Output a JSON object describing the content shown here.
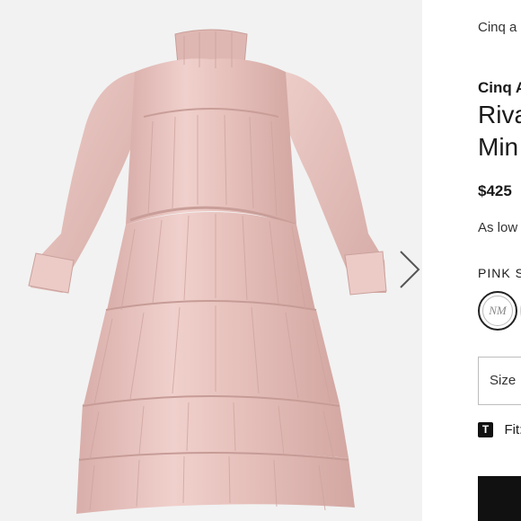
{
  "gallery": {
    "image": "pink pleated tiered mini dress",
    "next_icon": "chevron-right-icon"
  },
  "product": {
    "breadcrumb": "Cinq a",
    "brand": "Cinq A",
    "title_line_1": "Riva",
    "title_line_2": "Min",
    "price": "$425",
    "installment": "As low",
    "color_label": "PINK S",
    "swatch_text": "NM",
    "size_label": "Size",
    "fit_icon": "T",
    "fit_label": "Fit:"
  },
  "colors": {
    "gallery_bg": "#f2f2f2",
    "dress_pink": "#e8c4c0",
    "button_black": "#111111"
  }
}
